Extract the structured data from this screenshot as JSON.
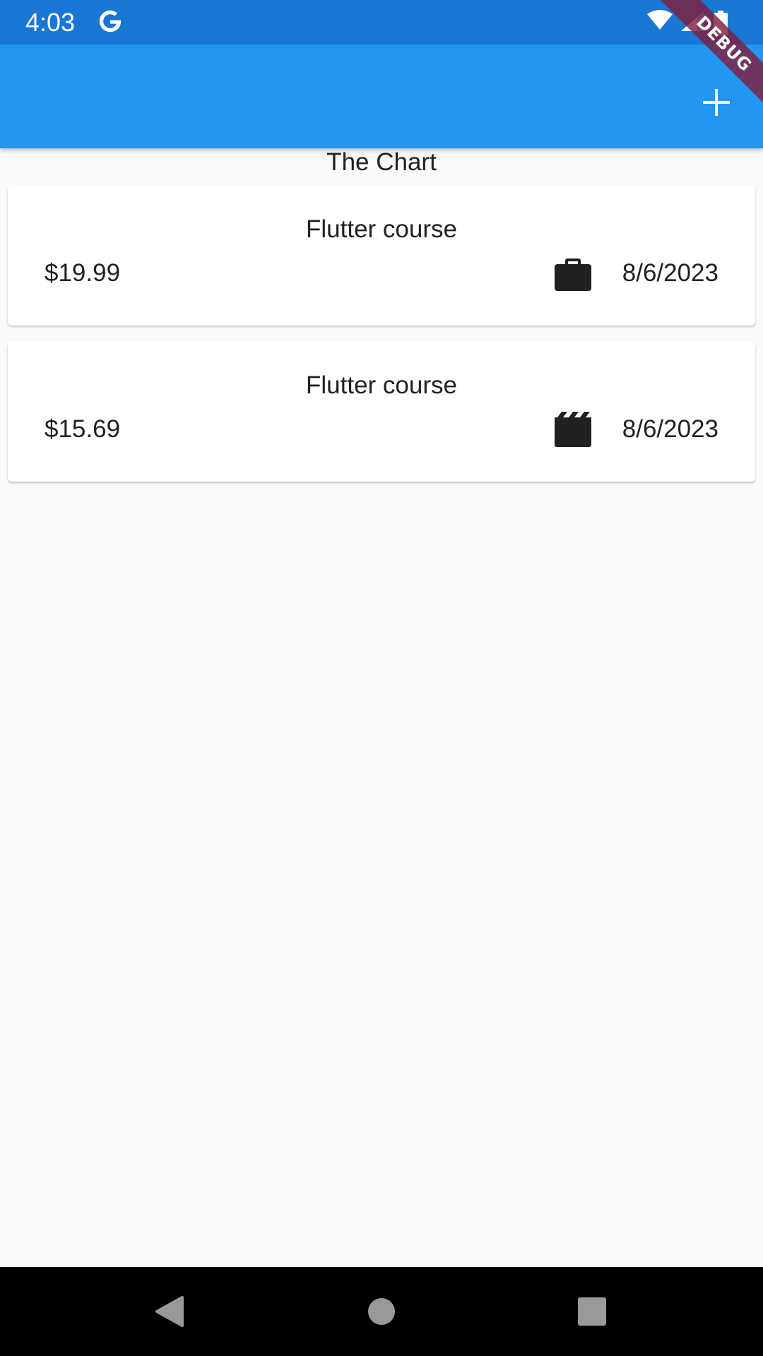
{
  "status_bar": {
    "time": "4:03",
    "icons": [
      "google-icon",
      "wifi-icon",
      "signal-icon",
      "battery-icon"
    ]
  },
  "app_bar": {
    "background": "#2196f3",
    "add_icon": "plus-icon"
  },
  "debug_banner": {
    "label": "DEBUG"
  },
  "main": {
    "chart_title": "The Chart",
    "transactions": [
      {
        "title": "Flutter course",
        "amount": "$19.99",
        "icon": "briefcase-icon",
        "date": "8/6/2023"
      },
      {
        "title": "Flutter course",
        "amount": "$15.69",
        "icon": "movie-clapper-icon",
        "date": "8/6/2023"
      }
    ]
  },
  "nav_bar": {
    "icons": [
      "back-icon",
      "home-icon",
      "recents-icon"
    ]
  },
  "colors": {
    "status_bar": "#1976d2",
    "app_bar": "#2196f3",
    "background": "#fafafa",
    "text": "#212121",
    "debug": "#802040"
  }
}
